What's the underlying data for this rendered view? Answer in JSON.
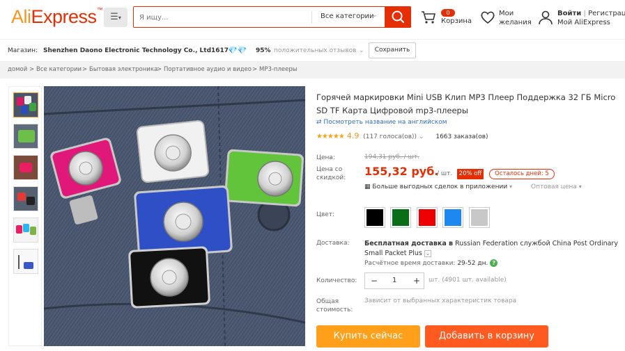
{
  "header": {
    "logo_part1": "Ali",
    "logo_part2": "Express",
    "search_placeholder": "Я ищу...",
    "all_categories": "Все категории",
    "cart_count": "0",
    "cart_label": "Корзина",
    "wishlist_label_1": "Мои",
    "wishlist_label_2": "желания",
    "login": "Войти",
    "register": "Регистраци",
    "my_aliexpress": "Мой AliExpress"
  },
  "store": {
    "label": "Магазин:",
    "name": "Shenzhen Daono Electronic Technology Co., Ltd",
    "score": "1617",
    "feedback_percent": "95%",
    "feedback_label": "положительных отзывов",
    "save_button": "Сохранить"
  },
  "breadcrumbs": [
    "домой",
    "Все категории",
    "Бытовая электроника",
    "Портативное аудио и видео",
    "MP3-плееры"
  ],
  "product": {
    "title": "Горячей маркировки Mini USB Клип MP3 Плеер Поддержка 32 ГБ Micro SD TF Карта Цифровой mp3-плееры",
    "translate_link": "Посмотреть название на английском",
    "rating": "4.9",
    "votes": "(117 голоса(ов))",
    "orders": "1663 заказа(ов)",
    "price_label": "Цена:",
    "old_price": "194,31 руб. / шт.",
    "discount_price_label_1": "Цена со",
    "discount_price_label_2": "скидкой:",
    "price": "155,32 руб.",
    "per_unit": "/ шт.",
    "discount": "20% off",
    "days_left": "Осталось дней: 5",
    "app_deals": "Больше выгодных сделок в приложении",
    "wholesale": "Оптовая цена",
    "color_label": "Цвет:",
    "colors": [
      "#000000",
      "#0a6e18",
      "#ee0000",
      "#1e88f0",
      "#c8c8c8"
    ],
    "delivery_label": "Доставка:",
    "delivery_free": "Бесплатная доставка в",
    "delivery_rest": "Russian Federation службой China Post Ordinary",
    "delivery_line2": "Small Packet Plus",
    "eta_label": "Расчётное время доставки:",
    "eta_value": "29-52 дн.",
    "quantity_label": "Количество:",
    "quantity": "1",
    "available": "шт. (4901 шт. available)",
    "total_label_1": "Общая",
    "total_label_2": "стоимость:",
    "total_value": "Зависит от выбранных характеристик товара",
    "buy_now": "Купить сейчас",
    "add_to_cart": "Добавить в корзину"
  }
}
